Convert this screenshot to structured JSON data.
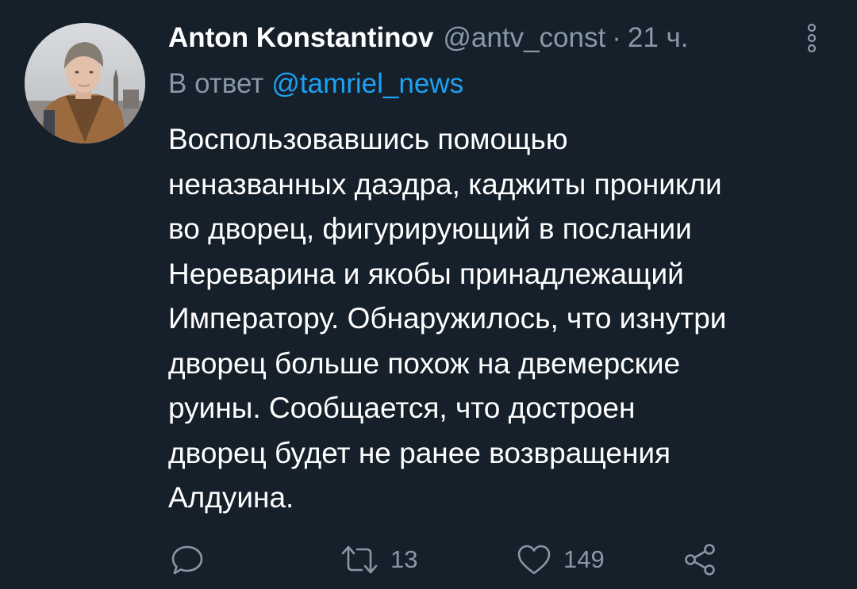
{
  "tweet": {
    "author_name": "Anton Konstantinov",
    "author_handle": "@antv_const",
    "separator": "·",
    "time": "21 ч.",
    "reply_prefix": "В ответ",
    "reply_to": "@tamriel_news",
    "body_lines": [
      "Воспользовавшись помощью",
      "неназванных даэдра, каджиты проникли",
      "во дворец, фигурирующий в послании",
      "Нереварина и якобы принадлежащий",
      "Императору. Обнаружилось, что изнутри",
      "дворец больше похож на двемерские",
      "руины. Сообщается, что достроен",
      "дворец будет не ранее возвращения",
      "Алдуина."
    ]
  },
  "actions": {
    "reply_icon": "reply-icon",
    "retweet_icon": "retweet-icon",
    "retweet_count": "13",
    "like_icon": "heart-icon",
    "like_count": "149",
    "share_icon": "share-icon"
  },
  "colors": {
    "background": "#15202b",
    "primary_text": "#ffffff",
    "secondary_text": "#8899a6",
    "link": "#1da1f2"
  }
}
